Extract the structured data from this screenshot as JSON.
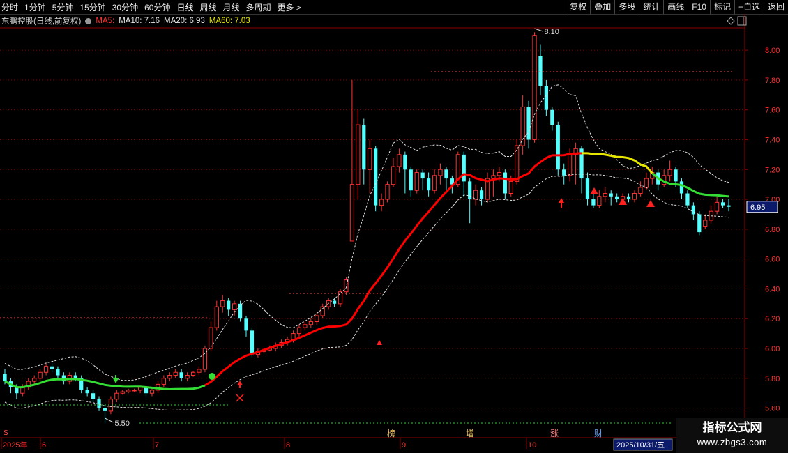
{
  "toolbar": {
    "left": [
      "分时",
      "1分钟",
      "5分钟",
      "15分钟",
      "30分钟",
      "60分钟",
      "日线",
      "周线",
      "月线",
      "多周期",
      "更多 >"
    ],
    "active_index": 6,
    "right": [
      "复权",
      "叠加",
      "多股",
      "统计",
      "画线",
      "F10",
      "标记",
      "+自选",
      "返回"
    ]
  },
  "legend": {
    "title": "东鹏控股(日线,前复权)",
    "ma5": "MA5:",
    "ma10": "MA10: 7.16",
    "ma20": "MA20: 6.93",
    "ma60": "MA60: 7.03"
  },
  "colors": {
    "up": "#ff3232",
    "down": "#54ffff",
    "grid": "#8b0000",
    "ma_line_red": "#ff0000",
    "ma_line_green": "#33dd33",
    "ma_line_yellow": "#e6e600",
    "axis_text": "#ff3232",
    "price_tag_bg": "#0b1a6a"
  },
  "y_axis": {
    "min": 5.5,
    "max": 8.15,
    "ticks": [
      "8.00",
      "7.80",
      "7.60",
      "7.40",
      "7.20",
      "7.00",
      "6.80",
      "6.60",
      "6.40",
      "6.20",
      "6.00",
      "5.80",
      "5.60"
    ],
    "current_price": "6.95"
  },
  "annotations": {
    "high_label": "8.10",
    "low_label": "5.50"
  },
  "x_axis": {
    "labels": [
      "2025年",
      "6",
      "7",
      "8",
      "9",
      "10"
    ],
    "date_tag": "2025/10/31/五"
  },
  "markers": [
    "榜",
    "增",
    "涨",
    "财"
  ],
  "watermark": {
    "title": "指标公式网",
    "url": "www.zbgs3.com"
  },
  "chart_data": {
    "type": "candlestick",
    "title": "东鹏控股(日线,前复权)",
    "ylim": [
      5.5,
      8.15
    ],
    "candles": [
      [
        5.83,
        5.78,
        5.86,
        5.76
      ],
      [
        5.78,
        5.74,
        5.8,
        5.7
      ],
      [
        5.74,
        5.7,
        5.76,
        5.66
      ],
      [
        5.7,
        5.74,
        5.76,
        5.68
      ],
      [
        5.74,
        5.78,
        5.8,
        5.72
      ],
      [
        5.78,
        5.8,
        5.82,
        5.76
      ],
      [
        5.8,
        5.84,
        5.86,
        5.78
      ],
      [
        5.84,
        5.88,
        5.9,
        5.82
      ],
      [
        5.88,
        5.86,
        5.9,
        5.84
      ],
      [
        5.86,
        5.82,
        5.88,
        5.8
      ],
      [
        5.82,
        5.78,
        5.84,
        5.76
      ],
      [
        5.78,
        5.82,
        5.84,
        5.76
      ],
      [
        5.82,
        5.8,
        5.84,
        5.78
      ],
      [
        5.8,
        5.72,
        5.82,
        5.7
      ],
      [
        5.72,
        5.7,
        5.74,
        5.68
      ],
      [
        5.7,
        5.66,
        5.72,
        5.64
      ],
      [
        5.66,
        5.6,
        5.68,
        5.58
      ],
      [
        5.6,
        5.58,
        5.62,
        5.5
      ],
      [
        5.58,
        5.66,
        5.68,
        5.56
      ],
      [
        5.66,
        5.7,
        5.72,
        5.64
      ],
      [
        5.7,
        5.71,
        5.72,
        5.69
      ],
      [
        5.71,
        5.72,
        5.73,
        5.7
      ],
      [
        5.72,
        5.72,
        5.73,
        5.71
      ],
      [
        5.72,
        5.74,
        5.75,
        5.7
      ],
      [
        5.74,
        5.7,
        5.75,
        5.68
      ],
      [
        5.7,
        5.72,
        5.74,
        5.68
      ],
      [
        5.72,
        5.76,
        5.78,
        5.7
      ],
      [
        5.76,
        5.8,
        5.82,
        5.74
      ],
      [
        5.8,
        5.82,
        5.84,
        5.78
      ],
      [
        5.82,
        5.84,
        5.86,
        5.8
      ],
      [
        5.84,
        5.8,
        5.86,
        5.78
      ],
      [
        5.8,
        5.82,
        5.84,
        5.78
      ],
      [
        5.82,
        5.84,
        5.85,
        5.81
      ],
      [
        5.84,
        5.86,
        5.88,
        5.82
      ],
      [
        5.86,
        6.0,
        6.02,
        5.84
      ],
      [
        6.0,
        6.14,
        6.18,
        5.98
      ],
      [
        6.14,
        6.28,
        6.32,
        6.12
      ],
      [
        6.28,
        6.32,
        6.36,
        6.24
      ],
      [
        6.32,
        6.26,
        6.34,
        6.22
      ],
      [
        6.26,
        6.3,
        6.32,
        6.22
      ],
      [
        6.3,
        6.2,
        6.32,
        6.18
      ],
      [
        6.2,
        6.12,
        6.22,
        6.08
      ],
      [
        6.12,
        5.96,
        6.14,
        5.94
      ],
      [
        5.96,
        5.98,
        6.0,
        5.94
      ],
      [
        5.98,
        5.99,
        6.0,
        5.97
      ],
      [
        5.99,
        6.0,
        6.02,
        5.98
      ],
      [
        6.0,
        6.02,
        6.04,
        5.98
      ],
      [
        6.02,
        6.04,
        6.06,
        6.0
      ],
      [
        6.04,
        6.06,
        6.08,
        6.02
      ],
      [
        6.06,
        6.1,
        6.12,
        6.04
      ],
      [
        6.1,
        6.14,
        6.16,
        6.08
      ],
      [
        6.14,
        6.16,
        6.18,
        6.12
      ],
      [
        6.16,
        6.18,
        6.2,
        6.14
      ],
      [
        6.18,
        6.22,
        6.24,
        6.16
      ],
      [
        6.22,
        6.28,
        6.3,
        6.2
      ],
      [
        6.28,
        6.32,
        6.34,
        6.26
      ],
      [
        6.32,
        6.3,
        6.34,
        6.28
      ],
      [
        6.3,
        6.38,
        6.4,
        6.28
      ],
      [
        6.38,
        6.46,
        6.48,
        6.36
      ],
      [
        6.72,
        7.1,
        7.8,
        6.72
      ],
      [
        7.1,
        7.5,
        7.6,
        7.0
      ],
      [
        7.5,
        7.2,
        7.54,
        7.1
      ],
      [
        7.2,
        7.34,
        7.4,
        7.04
      ],
      [
        7.34,
        6.96,
        7.36,
        6.92
      ],
      [
        6.96,
        7.0,
        7.04,
        6.92
      ],
      [
        7.0,
        7.1,
        7.12,
        6.98
      ],
      [
        7.1,
        7.22,
        7.28,
        7.08
      ],
      [
        7.22,
        7.3,
        7.34,
        7.18
      ],
      [
        7.3,
        7.2,
        7.32,
        7.04
      ],
      [
        7.2,
        7.06,
        7.22,
        7.02
      ],
      [
        7.06,
        7.18,
        7.2,
        7.04
      ],
      [
        7.18,
        7.14,
        7.2,
        7.06
      ],
      [
        7.14,
        7.06,
        7.18,
        7.02
      ],
      [
        7.06,
        7.16,
        7.2,
        7.04
      ],
      [
        7.16,
        7.2,
        7.24,
        7.1
      ],
      [
        7.2,
        7.14,
        7.22,
        7.04
      ],
      [
        7.14,
        7.1,
        7.16,
        7.04
      ],
      [
        7.1,
        7.3,
        7.32,
        7.08
      ],
      [
        7.3,
        7.12,
        7.32,
        7.02
      ],
      [
        7.12,
        7.0,
        7.14,
        6.84
      ],
      [
        7.0,
        7.06,
        7.1,
        6.96
      ],
      [
        7.06,
        7.0,
        7.08,
        6.96
      ],
      [
        7.0,
        7.14,
        7.18,
        6.98
      ],
      [
        7.14,
        7.16,
        7.2,
        7.02
      ],
      [
        7.16,
        7.18,
        7.22,
        7.12
      ],
      [
        7.18,
        7.04,
        7.2,
        7.0
      ],
      [
        7.04,
        7.12,
        7.16,
        7.02
      ],
      [
        7.12,
        7.36,
        7.4,
        7.1
      ],
      [
        7.36,
        7.62,
        7.7,
        7.3
      ],
      [
        7.62,
        7.4,
        7.66,
        7.34
      ],
      [
        7.4,
        8.1,
        8.12,
        7.38
      ],
      [
        7.96,
        7.76,
        8.04,
        7.7
      ],
      [
        7.76,
        7.6,
        7.8,
        7.56
      ],
      [
        7.6,
        7.5,
        7.62,
        7.46
      ],
      [
        7.5,
        7.2,
        7.52,
        7.16
      ],
      [
        7.2,
        7.16,
        7.24,
        7.1
      ],
      [
        7.16,
        7.3,
        7.34,
        7.12
      ],
      [
        7.3,
        7.34,
        7.38,
        7.1
      ],
      [
        7.34,
        7.14,
        7.36,
        7.04
      ],
      [
        7.14,
        7.0,
        7.18,
        6.96
      ],
      [
        7.0,
        6.96,
        7.04,
        6.94
      ],
      [
        6.96,
        7.02,
        7.06,
        6.94
      ],
      [
        7.02,
        7.04,
        7.08,
        6.98
      ],
      [
        7.04,
        7.02,
        7.06,
        6.96
      ],
      [
        7.02,
        7.0,
        7.04,
        6.98
      ],
      [
        7.0,
        7.02,
        7.04,
        6.98
      ],
      [
        7.02,
        7.0,
        7.04,
        6.98
      ],
      [
        7.0,
        7.04,
        7.06,
        6.98
      ],
      [
        7.04,
        7.08,
        7.12,
        7.02
      ],
      [
        7.08,
        7.14,
        7.18,
        7.06
      ],
      [
        7.14,
        7.18,
        7.22,
        7.1
      ],
      [
        7.18,
        7.1,
        7.2,
        7.06
      ],
      [
        7.1,
        7.16,
        7.2,
        7.08
      ],
      [
        7.16,
        7.2,
        7.26,
        7.12
      ],
      [
        7.2,
        7.12,
        7.22,
        7.08
      ],
      [
        7.12,
        7.04,
        7.14,
        7.0
      ],
      [
        7.04,
        6.96,
        7.06,
        6.94
      ],
      [
        6.96,
        6.9,
        6.98,
        6.86
      ],
      [
        6.9,
        6.78,
        6.92,
        6.76
      ],
      [
        6.82,
        6.86,
        6.9,
        6.8
      ],
      [
        6.86,
        6.92,
        6.96,
        6.84
      ],
      [
        6.92,
        6.98,
        7.02,
        6.9
      ],
      [
        6.98,
        6.96,
        7.0,
        6.94
      ],
      [
        6.96,
        6.95,
        7.0,
        6.92
      ]
    ]
  }
}
